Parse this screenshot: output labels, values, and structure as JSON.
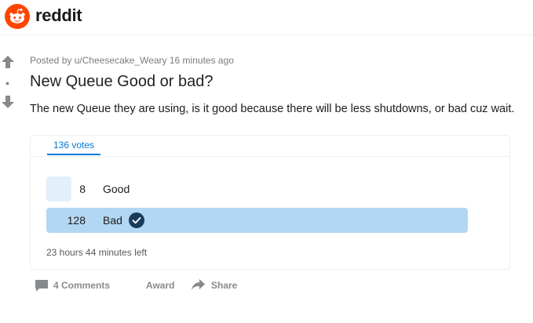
{
  "header": {
    "brand": "reddit",
    "logo_icon": "reddit-snoo-icon",
    "brand_color": "#ff4500"
  },
  "post": {
    "meta": "Posted by u/Cheesecake_Weary 16 minutes ago",
    "title": "New Queue Good or bad?",
    "body": "The new Queue they are using, is it good because there will be less shutdowns, or bad cuz wait.",
    "vote_score": "•"
  },
  "poll": {
    "votes_tab": "136 votes",
    "options": [
      {
        "count": "8",
        "label": "Good",
        "fraction": 0.0588,
        "color": "#e2f0fb"
      },
      {
        "count": "128",
        "label": "Bad",
        "fraction": 1.0,
        "color": "#b3d7f2",
        "selected": true
      }
    ],
    "time_left": "23 hours 44 minutes left",
    "accent_color": "#0079d3"
  },
  "actions": {
    "comments": "4 Comments",
    "award": "Award",
    "share": "Share"
  }
}
